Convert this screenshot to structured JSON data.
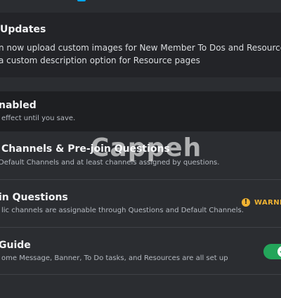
{
  "updates": {
    "title": "Updates",
    "line1": "n now upload custom images for New Member To Dos and Resource Page",
    "line2": "a custom description option for Resource pages"
  },
  "enabled": {
    "title": "nabled",
    "description": "effect until you save."
  },
  "rows": {
    "channels": {
      "title": "Channels & Pre-join Questions",
      "description": "Default Channels and at least channels assigned by questions."
    },
    "questions": {
      "title": "in Questions",
      "description": "lic channels are assignable through Questions and Default Channels.",
      "status_label": "WARNIN",
      "status_icon": "warning-icon",
      "status_color": "#f0b232"
    },
    "guide": {
      "title": "Guide",
      "description": "ome Message, Banner, To Do tasks, and Resources are all set up",
      "toggle_on": true,
      "toggle_color": "#23a55a"
    }
  },
  "watermark": "Cappeh"
}
